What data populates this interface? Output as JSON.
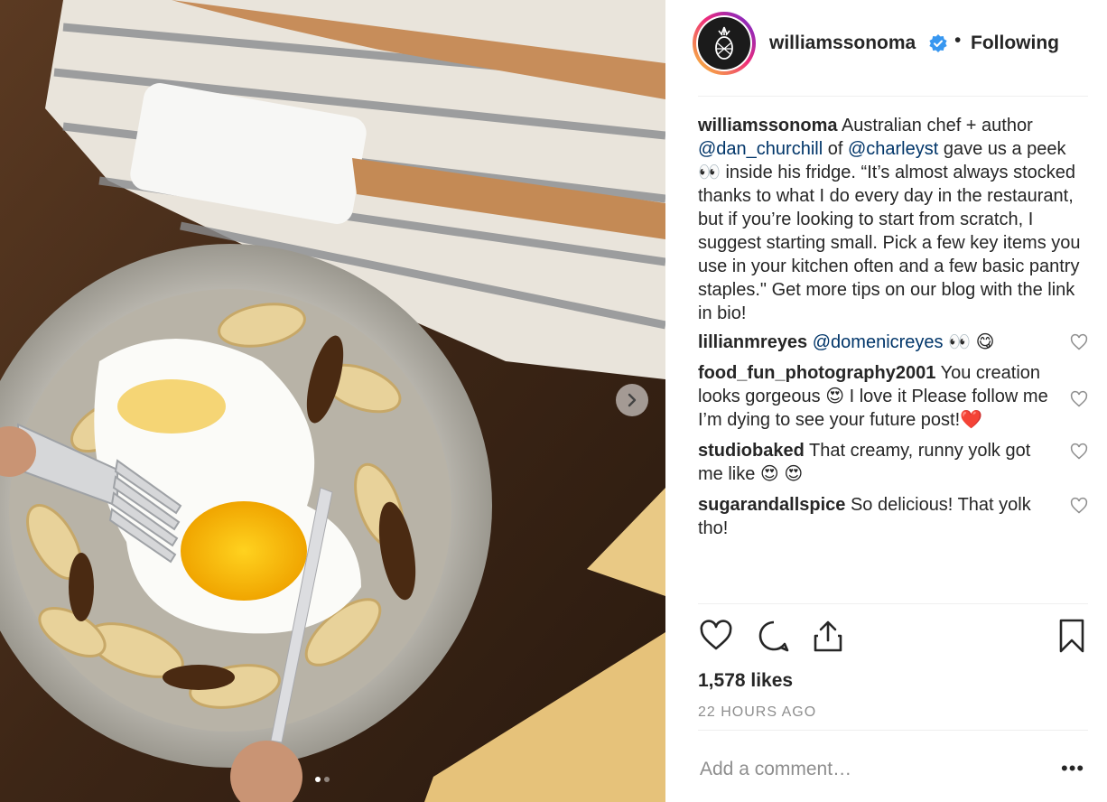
{
  "post": {
    "username": "williamssonoma",
    "follow_status": "Following",
    "separator": "•",
    "caption": {
      "username": "williamssonoma",
      "part1": "Australian chef + author ",
      "mention1": "@dan_churchill",
      "part2": " of ",
      "mention2": "@charleyst",
      "part3": " gave us a peek ",
      "emoji1": "👀",
      "part4": " inside his fridge. “It’s almost always stocked thanks to what I do every day in the restaurant, but if you’re looking to start from scratch, I suggest starting small. Pick a few key items you use in your kitchen often and a few basic pantry staples.\" Get more tips on our blog with the link in bio!"
    },
    "comments": [
      {
        "username": "lillianmreyes",
        "mention": "@domenicreyes",
        "text_after": " 👀 😋"
      },
      {
        "username": "food_fun_photography2001",
        "text": "You creation looks gorgeous 😍  I love it Please follow me I’m dying to see your future post!❤️"
      },
      {
        "username": "studiobaked",
        "text": "That creamy, runny yolk got me like 😍 😍"
      },
      {
        "username": "sugarandallspice",
        "text": "So delicious! That yolk tho!"
      }
    ],
    "likes": "1,578 likes",
    "timestamp": "22 HOURS AGO",
    "add_comment_placeholder": "Add a comment…",
    "more_label": "•••",
    "carousel": {
      "total": 2,
      "current": 1
    }
  },
  "icons": {
    "like": "heart-icon",
    "comment": "comment-icon",
    "share": "share-icon",
    "save": "bookmark-icon",
    "next": "chevron-right-icon",
    "verified": "verified-badge-icon"
  },
  "colors": {
    "text": "#262626",
    "muted": "#8e8e8e",
    "mention": "#003569",
    "verified": "#3897f0"
  }
}
